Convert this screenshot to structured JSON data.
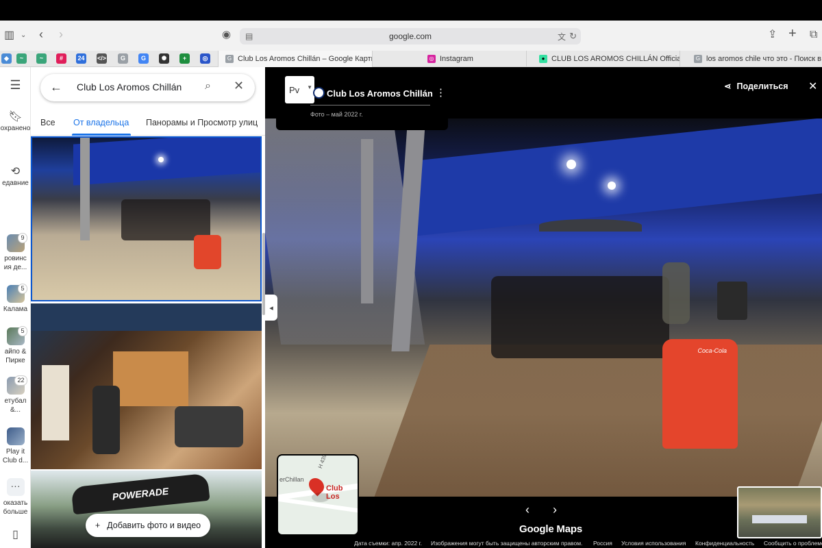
{
  "browser": {
    "url": "google.com",
    "tabs": [
      {
        "title": "Club Los Aromos Chillán – Google Карты",
        "active": true
      },
      {
        "title": "Instagram",
        "active": false
      },
      {
        "title": "CLUB LOS AROMOS CHILLÁN Official: I...",
        "active": false
      },
      {
        "title": "los aromos chile что это - Поиск в Goo...",
        "active": false
      }
    ],
    "favorites_icons": [
      "maps-icon",
      "chart-icon",
      "chart-icon",
      "slack-icon",
      "cloud24-icon",
      "code-icon",
      "google-icon",
      "translate-icon",
      "openai-icon",
      "sheets-icon",
      "circle-app-icon"
    ]
  },
  "rail": {
    "items": [
      {
        "label": "охранено",
        "icon": "bookmark-icon"
      },
      {
        "label": "едавние",
        "icon": "history-icon"
      },
      {
        "label": "ровинс ия де...",
        "count": "9"
      },
      {
        "label": "Калама",
        "count": "5"
      },
      {
        "label": "айпо & Пирке",
        "count": "5"
      },
      {
        "label": "етубал &...",
        "count": "22"
      },
      {
        "label": "Play it Club d..."
      },
      {
        "label": "оказать больше"
      }
    ]
  },
  "panel": {
    "search_query": "Club Los Aromos Chillán",
    "tabs": [
      "Все",
      "От владельца",
      "Панорамы и Просмотр улиц"
    ],
    "active_tab": "От владельца",
    "add_button": "Добавить фото и видео",
    "arch_text": "POWERADE"
  },
  "viewer": {
    "pv_label": "Pv",
    "title": "Club Los Aromos Chillán",
    "photo_date": "Фото – май 2022 г.",
    "share_label": "Поделиться",
    "minimap": {
      "road_label": "H 439",
      "left_label": "erChillan",
      "place_label": "Club Los"
    },
    "logo": "Google Maps",
    "footer": {
      "capture_date": "Дата съемки: апр. 2022 г.",
      "copyright": "Изображения могут быть защищены авторским правом.",
      "country": "Россия",
      "terms": "Условия использования",
      "privacy": "Конфиденциальность",
      "report": "Сообщить о проблеме"
    },
    "scene_sign": "Coca-Cola"
  }
}
